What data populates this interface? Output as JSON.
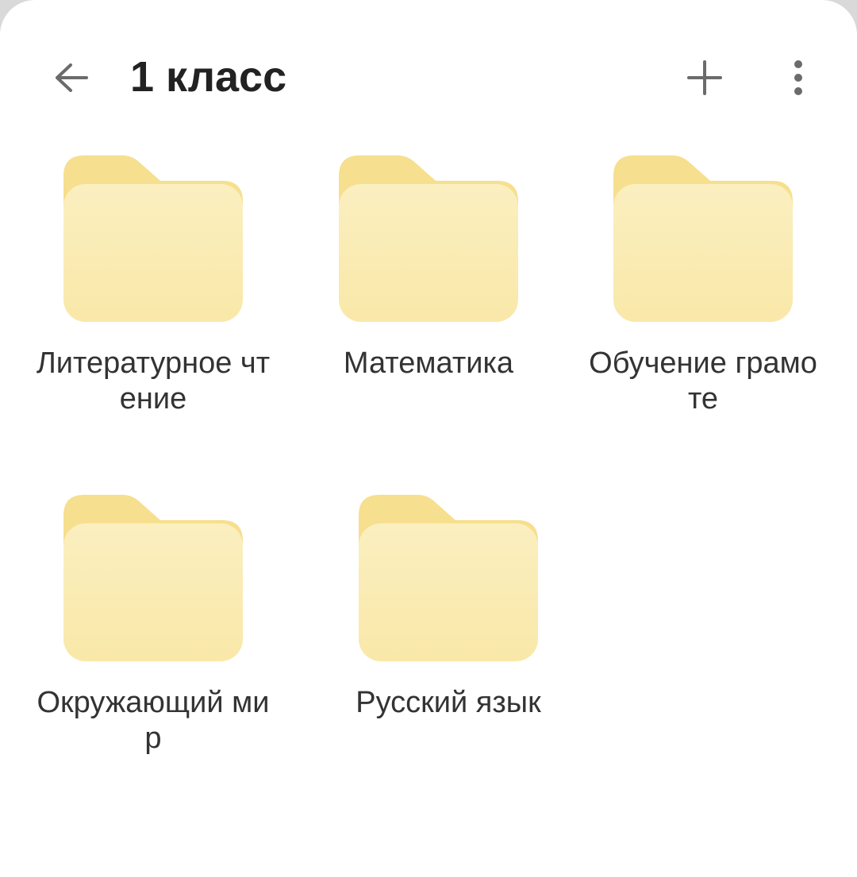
{
  "header": {
    "title": "1 класс",
    "back_icon": "arrow-left-icon",
    "add_icon": "plus-icon",
    "more_icon": "vertical-dots-icon"
  },
  "colors": {
    "folder_back": "#f6df8e",
    "folder_front_top": "#fbefc0",
    "folder_front_bottom": "#f9e9ab",
    "text": "#333333",
    "icon": "#6b6b6b"
  },
  "folders": [
    {
      "name": "Литературное чтение"
    },
    {
      "name": "Математика"
    },
    {
      "name": "Обучение грамоте"
    },
    {
      "name": "Окружающий мир"
    },
    {
      "name": "Русский язык"
    }
  ]
}
